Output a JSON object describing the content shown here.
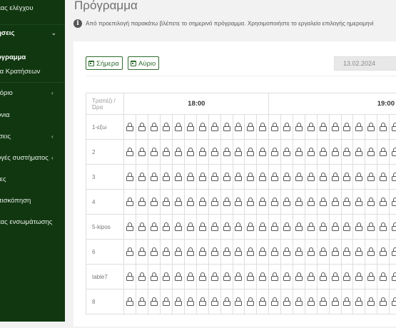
{
  "sidebar": {
    "items": [
      {
        "label": "κας ελέγχου",
        "chevron": ""
      },
      {
        "label": "ήσεις",
        "chevron": "⌄"
      },
      {
        "label": "όγραμμα",
        "chevron": ""
      },
      {
        "label": "τα Κρατήσεων",
        "chevron": ""
      },
      {
        "label": "τόριο",
        "chevron": "‹"
      },
      {
        "label": "όνια",
        "chevron": ""
      },
      {
        "label": "ίσεις",
        "chevron": "‹"
      },
      {
        "label": "ογές συστήματος",
        "chevron": "‹"
      },
      {
        "label": "τες",
        "chevron": ""
      },
      {
        "label": "πισκόπηση",
        "chevron": ""
      },
      {
        "label": "κας ενσωμάτωσης",
        "chevron": ""
      }
    ]
  },
  "page": {
    "title": "Πρόγραμμα",
    "info_text": "Από προεπιλογή παρακάτω βλέπετε το σημερινό πρόγραμμα. Χρησιμοποιήστε το εργαλείο επιλογής ημερομηνί"
  },
  "toolbar": {
    "today_label": "Σήμερα",
    "tomorrow_label": "Αύριο",
    "date_value": "13.02.2024"
  },
  "grid": {
    "corner_label": "Τραπέζι / Ώρα",
    "hours": [
      "18:00",
      "19:00"
    ],
    "rows": [
      "1-εξω",
      "2",
      "3",
      "4",
      "5-kipos",
      "6",
      "table7",
      "8"
    ]
  }
}
